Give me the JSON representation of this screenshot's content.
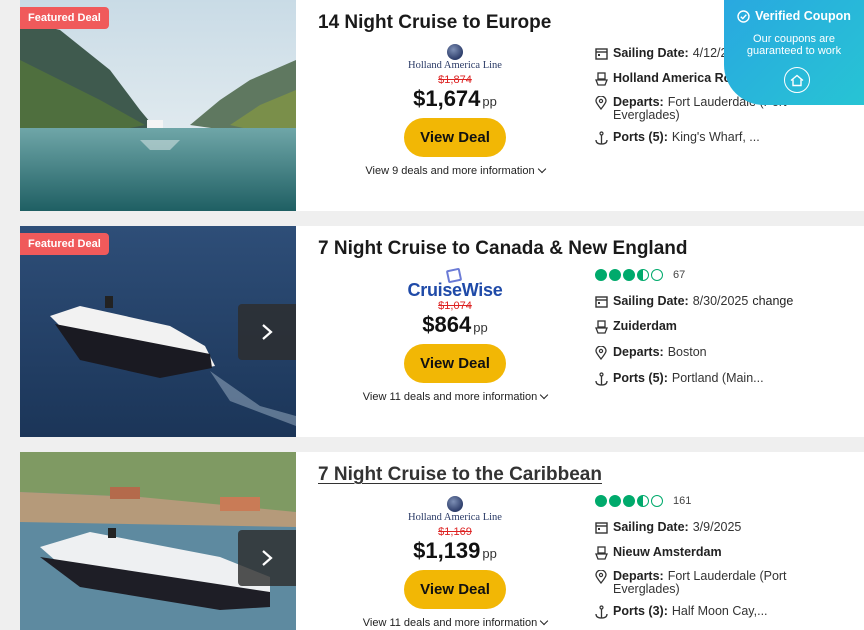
{
  "badge": {
    "title": "Verified Coupon",
    "subtitle_line1": "Our coupons are",
    "subtitle_line2": "guaranteed to work"
  },
  "cards": [
    {
      "featured": "Featured Deal",
      "title": "14 Night Cruise to Europe",
      "logo": "Holland America Line",
      "old_price": "$1,874",
      "price": "$1,674",
      "pp": "pp",
      "button": "View Deal",
      "more": "View 9 deals and more information",
      "sailing_label": "Sailing Date:",
      "sailing_value": "4/12/2025",
      "ship": "Holland America Rotterdam",
      "departs_label": "Departs:",
      "departs_value": "Fort Lauderdale (Port Everglades)",
      "ports_label": "Ports (5):",
      "ports_value": "King's Wharf, ..."
    },
    {
      "featured": "Featured Deal",
      "title": "7 Night Cruise to Canada & New England",
      "logo": "CruiseWise",
      "old_price": "$1,074",
      "price": "$864",
      "pp": "pp",
      "button": "View Deal",
      "more": "View 11 deals and more information",
      "rating_count": "67",
      "rating_value": 3.5,
      "sailing_label": "Sailing Date:",
      "sailing_value": "8/30/2025",
      "sailing_action": "change",
      "ship": "Zuiderdam",
      "departs_label": "Departs:",
      "departs_value": "Boston",
      "ports_label": "Ports (5):",
      "ports_value": "Portland (Main..."
    },
    {
      "title": "7 Night Cruise to the Caribbean",
      "logo": "Holland America Line",
      "old_price": "$1,169",
      "price": "$1,139",
      "pp": "pp",
      "button": "View Deal",
      "more": "View 11 deals and more information",
      "rating_count": "161",
      "rating_value": 3.5,
      "sailing_label": "Sailing Date:",
      "sailing_value": "3/9/2025",
      "ship": "Nieuw Amsterdam",
      "departs_label": "Departs:",
      "departs_value": "Fort Lauderdale (Port Everglades)",
      "ports_label": "Ports (3):",
      "ports_value": "Half Moon Cay,..."
    }
  ],
  "colors": {
    "accent_button": "#f2b705",
    "featured": "#f05a5b",
    "rating": "#00aa6c",
    "old_price": "#d22222",
    "badge": "#29a8e0"
  }
}
